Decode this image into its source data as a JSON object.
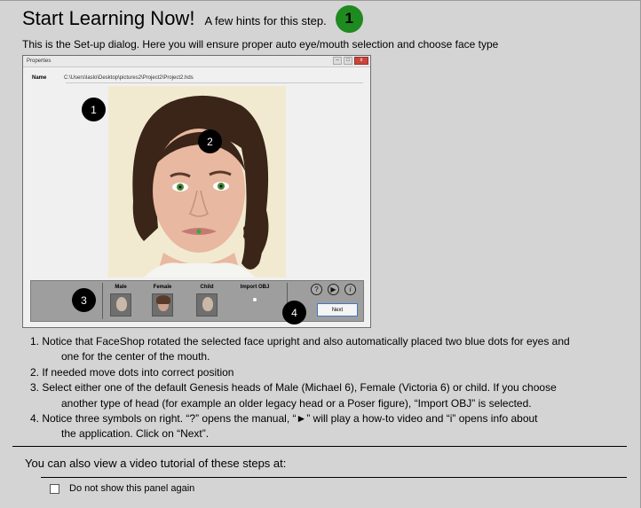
{
  "header": {
    "title": "Start Learning Now!",
    "subtitle": "A few hints for this step.",
    "step_number": "1"
  },
  "intro": "This is the Set-up dialog. Here you will ensure proper auto eye/mouth selection and choose face type",
  "dialog": {
    "window_title": "Properties",
    "window_buttons": [
      "–",
      "□",
      "x"
    ],
    "name_label": "Name",
    "file_path": "C:\\Users\\laslo\\Desktop\\pictures2\\Project2\\Project2.hds",
    "callouts": [
      "1",
      "2",
      "3",
      "4"
    ],
    "head_types": [
      "Male",
      "Female",
      "Child",
      "Import OBJ"
    ],
    "tool_icons": [
      {
        "icon": "help-icon",
        "glyph": "?"
      },
      {
        "icon": "play-icon",
        "glyph": "▶"
      },
      {
        "icon": "info-icon",
        "glyph": "i"
      }
    ],
    "next_label": "Next"
  },
  "steps": [
    "1. Notice that FaceShop rotated the selected face upright and also automatically placed two blue dots for eyes and",
    "one for the center of the mouth.",
    "2. If needed move dots into correct position",
    "3. Select either one of the default Genesis heads of Male (Michael 6), Female (Victoria 6) or child. If you choose",
    "another type of head (for example an older legacy head or a Poser figure), “Import OBJ” is selected.",
    "4. Notice three symbols on right. “?” opens the manual, “►” will play a how-to video and “i” opens info about",
    "the application. Click on “Next”."
  ],
  "video_text": "You can also view a video tutorial of these steps at:",
  "checkbox": {
    "label": "Do not show this panel again",
    "checked": false
  },
  "colors": {
    "background": "#d4d4d4",
    "badge_green": "#1f8a1f",
    "callout_black": "#000000",
    "next_border": "#3c78c8"
  }
}
